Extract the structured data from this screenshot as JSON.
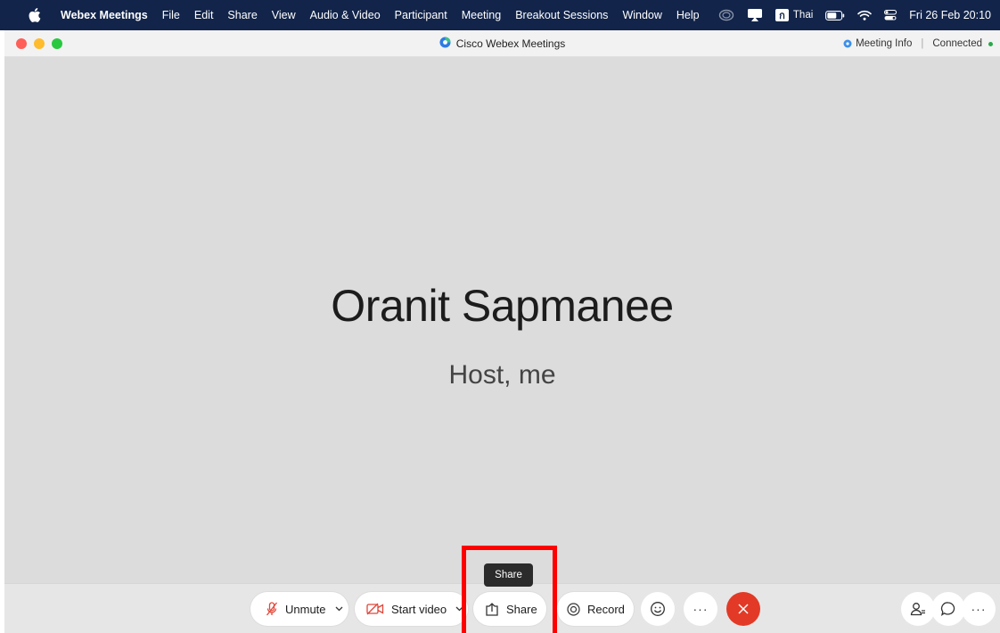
{
  "menubar": {
    "app_name": "Webex Meetings",
    "items": [
      "File",
      "Edit",
      "Share",
      "View",
      "Audio & Video",
      "Participant",
      "Meeting",
      "Breakout Sessions",
      "Window",
      "Help"
    ],
    "input_source_glyph": "ก",
    "input_source_label": "Thai",
    "clock": "Fri 26 Feb  20:10"
  },
  "window": {
    "title": "Cisco Webex Meetings",
    "meeting_info_label": "Meeting Info",
    "connection_status": "Connected"
  },
  "stage": {
    "participant_name": "Oranit Sapmanee",
    "participant_role": "Host, me"
  },
  "tooltip": {
    "text": "Share"
  },
  "controls": {
    "unmute_label": "Unmute",
    "start_video_label": "Start video",
    "share_label": "Share",
    "record_label": "Record",
    "more_glyph": "···"
  },
  "colors": {
    "menubar_bg": "#12244a",
    "stage_bg": "#dcdcdc",
    "end_button": "#e23a26",
    "mute_icon": "#e0463a",
    "highlight": "#ff0000",
    "connected": "#2aa84a"
  },
  "icons": {
    "menubar": [
      "apple-logo-icon",
      "creative-cloud-icon",
      "screen-mirroring-icon",
      "battery-icon",
      "wifi-icon",
      "control-center-icon"
    ],
    "window": [
      "webex-logo-icon",
      "meeting-info-icon"
    ],
    "controls": [
      "microphone-muted-icon",
      "chevron-down-icon",
      "video-off-icon",
      "share-icon",
      "record-icon",
      "reactions-icon",
      "more-icon",
      "end-call-icon",
      "participants-icon",
      "chat-icon"
    ]
  }
}
